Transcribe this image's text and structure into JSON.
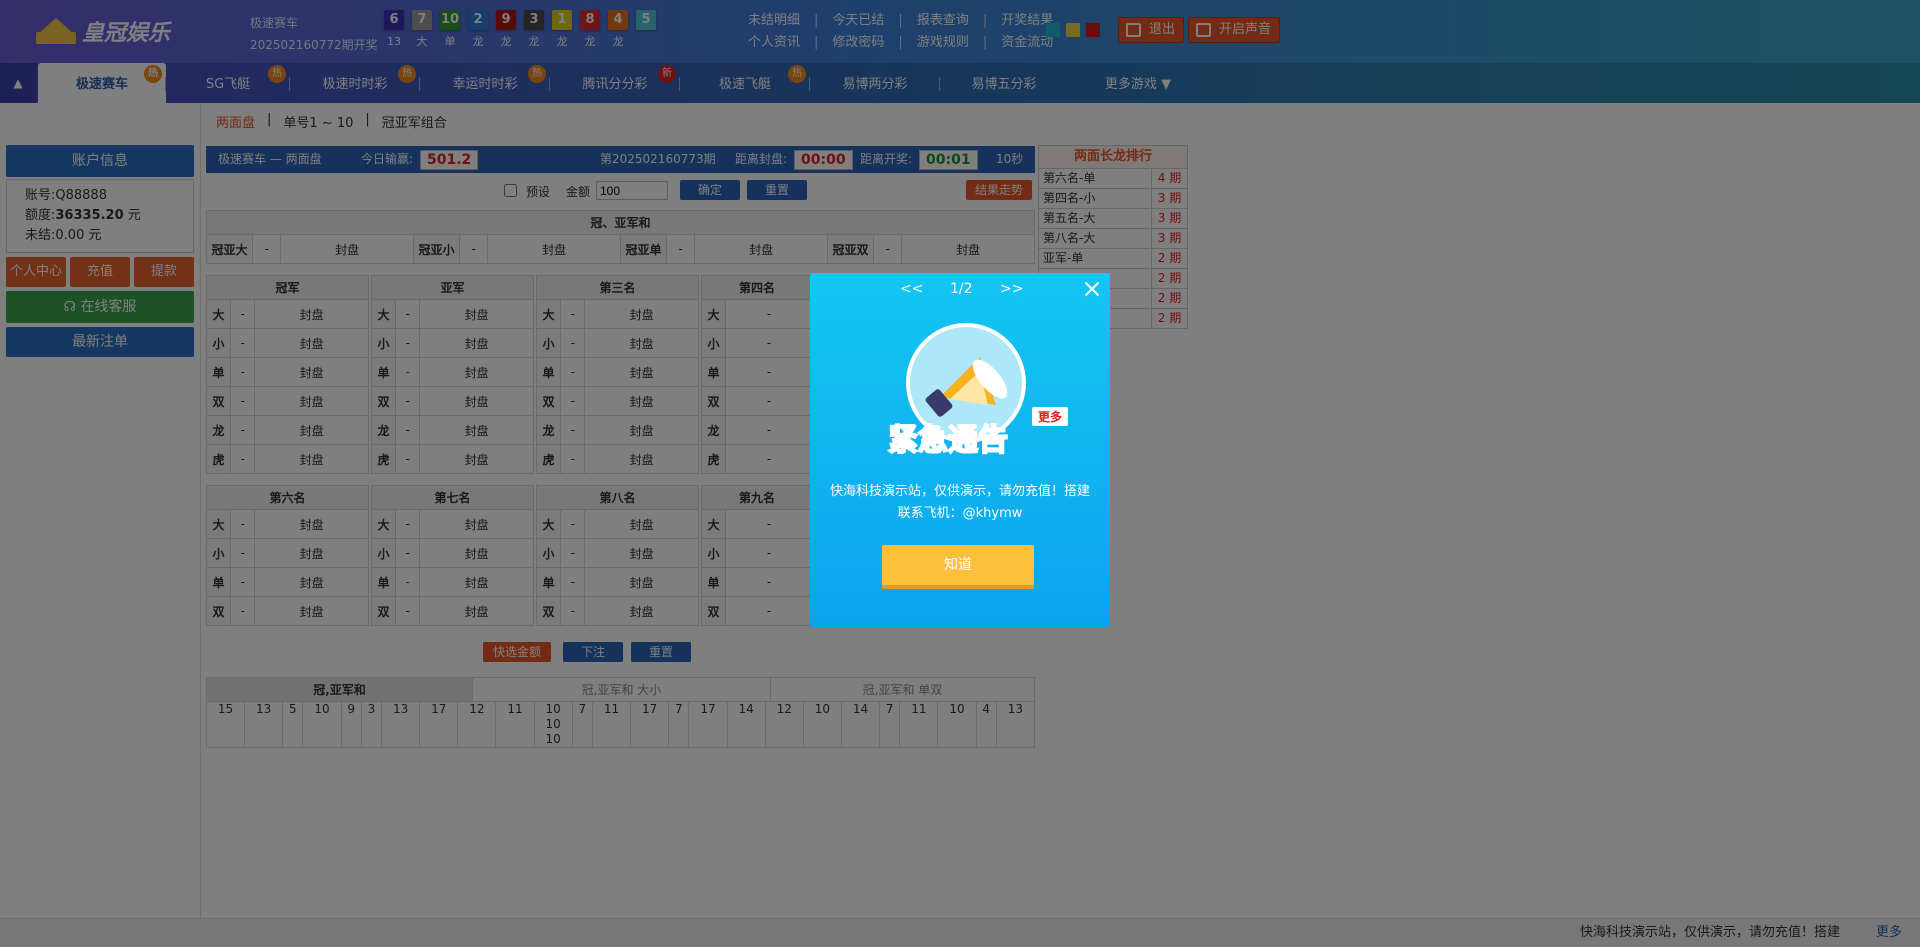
{
  "header": {
    "logo_text": "皇冠娱乐",
    "game_name": "极速赛车",
    "period_open": "202502160772期开奖",
    "balls": [
      {
        "num": "6",
        "color": "#3a2fb8"
      },
      {
        "num": "7",
        "color": "#9a9a9a"
      },
      {
        "num": "10",
        "color": "#2e9b2e"
      },
      {
        "num": "2",
        "color": "#2a7fd4"
      },
      {
        "num": "9",
        "color": "#b31414"
      },
      {
        "num": "3",
        "color": "#4a4a4a"
      },
      {
        "num": "1",
        "color": "#e0d01e"
      },
      {
        "num": "8",
        "color": "#e0282e"
      },
      {
        "num": "4",
        "color": "#e8701e"
      },
      {
        "num": "5",
        "color": "#4fc7d8"
      }
    ],
    "ball_attrs": [
      "13",
      "大",
      "单",
      "龙",
      "龙",
      "龙",
      "龙",
      "龙",
      "龙"
    ],
    "links_row1": [
      "未结明细",
      "今天已结",
      "报表查询",
      "开奖结果"
    ],
    "links_row2": [
      "个人资讯",
      "修改密码",
      "游戏规则",
      "资金流动"
    ],
    "logout_label": "退出",
    "sound_label": "开启声音",
    "theme_colors": [
      "#1fb6d6",
      "#f5d442",
      "#d01818"
    ]
  },
  "nav": {
    "items": [
      {
        "label": "极速赛车",
        "badge": "热",
        "active": true
      },
      {
        "label": "SG飞艇",
        "badge": "热"
      },
      {
        "label": "极速时时彩",
        "badge": "热"
      },
      {
        "label": "幸运时时彩",
        "badge": "热"
      },
      {
        "label": "腾讯分分彩",
        "badge": "新"
      },
      {
        "label": "极速飞艇",
        "badge": "热"
      },
      {
        "label": "易博两分彩",
        "badge": ""
      },
      {
        "label": "易博五分彩",
        "badge": ""
      },
      {
        "label": "更多游戏",
        "badge": ""
      }
    ],
    "collapse_icon": "up-arrow-icon"
  },
  "sidebar": {
    "title": "账户信息",
    "account_label": "账号:",
    "account": "Q88888",
    "credit_label": "额度:",
    "credit": "36335.20",
    "credit_unit": "元",
    "pending_label": "未结:",
    "pending": "0.00 元",
    "buttons": [
      "个人中心",
      "充值",
      "提款"
    ],
    "service": "在线客服",
    "latest": "最新注单"
  },
  "breadcrumb": [
    "两面盘",
    "单号1 ~ 10",
    "冠亚军组合"
  ],
  "bar": {
    "title": "极速赛车 — 两面盘",
    "today_label": "今日输赢:",
    "today_value": "501.2",
    "period": "第202502160773期",
    "close_label": "距离封盘:",
    "close_value": "00:00",
    "open_label": "距离开奖:",
    "open_value": "00:01",
    "refresh": "10秒"
  },
  "betform": {
    "preset_label": "预设",
    "amount_label": "金额",
    "amount_value": "100",
    "confirm": "确定",
    "reset": "重置",
    "trend": "结果走势"
  },
  "sum_table": {
    "title": "冠、亚军和",
    "cells": [
      {
        "name": "冠亚大",
        "odds": "-",
        "status": "封盘"
      },
      {
        "name": "冠亚小",
        "odds": "-",
        "status": "封盘"
      },
      {
        "name": "冠亚单",
        "odds": "-",
        "status": "封盘"
      },
      {
        "name": "冠亚双",
        "odds": "-",
        "status": "封盘"
      }
    ]
  },
  "rank_tables_1": {
    "titles": [
      "冠军",
      "亚军",
      "第三名",
      "第四名"
    ],
    "rows": [
      "大",
      "小",
      "单",
      "双",
      "龙",
      "虎"
    ],
    "odds": "-",
    "status": "封盘"
  },
  "rank_tables_2": {
    "titles": [
      "第六名",
      "第七名",
      "第八名",
      "第九名"
    ],
    "rows": [
      "大",
      "小",
      "单",
      "双"
    ],
    "odds": "-",
    "status": "封盘"
  },
  "bottom": {
    "quick_amount": "快选金额",
    "place_bet": "下注",
    "reset": "重置"
  },
  "stats": {
    "tabs": [
      "冠,亚军和",
      "冠,亚军和 大小",
      "冠,亚军和 单双"
    ],
    "values": [
      "15",
      "13",
      "5",
      "10",
      "9",
      "3",
      "13",
      "17",
      "12",
      "11",
      "10\n10\n10",
      "7",
      "11",
      "17",
      "7",
      "17",
      "14",
      "12",
      "10",
      "14",
      "7",
      "11",
      "10",
      "4",
      "13"
    ]
  },
  "lane": {
    "title": "两面长龙排行",
    "items": [
      {
        "name": "第六名-单",
        "val": "4 期"
      },
      {
        "name": "第四名-小",
        "val": "3 期"
      },
      {
        "name": "第五名-大",
        "val": "3 期"
      },
      {
        "name": "第八名-大",
        "val": "3 期"
      },
      {
        "name": "亚军-单",
        "val": "2 期"
      },
      {
        "name": "",
        "val": "2 期"
      },
      {
        "name": "",
        "val": "2 期"
      },
      {
        "name": "",
        "val": "2 期"
      }
    ]
  },
  "footer": {
    "marquee": "快海科技演示站，仅供演示，请勿充值！搭建",
    "more": "更多"
  },
  "modal": {
    "prev": "<<",
    "page": "1/2",
    "next": ">>",
    "headline": "紧急通告",
    "more_tag": "更多",
    "notice": "快海科技演示站，仅供演示，请勿充值！搭建联系飞机：@khymw",
    "ok": "知道"
  }
}
